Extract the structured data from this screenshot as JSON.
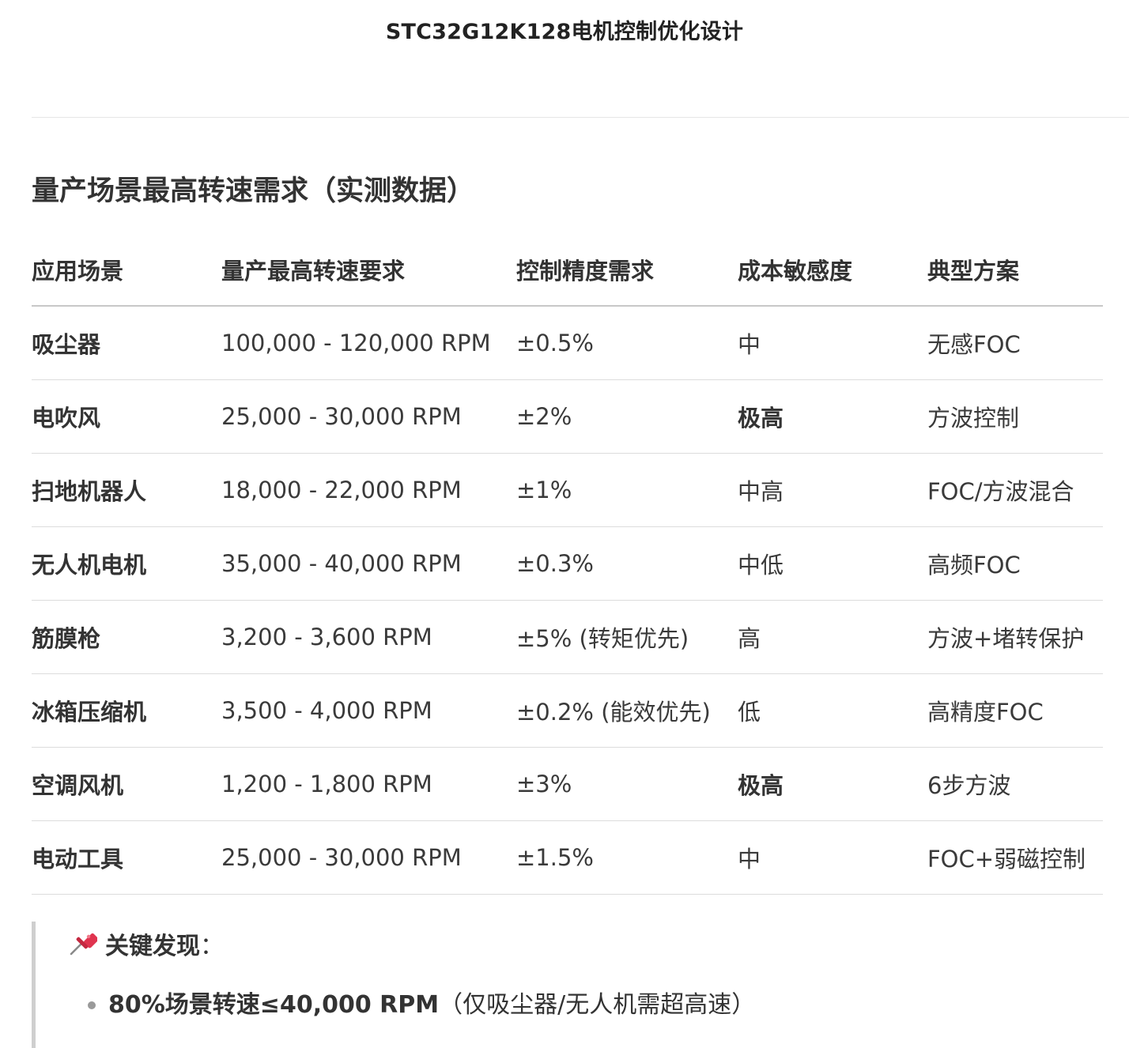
{
  "header": {
    "title": "STC32G12K128电机控制优化设计"
  },
  "section": {
    "title": "量产场景最高转速需求（实测数据）"
  },
  "table": {
    "columns": [
      "应用场景",
      "量产最高转速要求",
      "控制精度需求",
      "成本敏感度",
      "典型方案"
    ],
    "rows": [
      {
        "scene": "吸尘器",
        "speed": "100,000 - 120,000 RPM",
        "precision": "±0.5%",
        "cost": "中",
        "cost_emphasis": false,
        "solution": "无感FOC"
      },
      {
        "scene": "电吹风",
        "speed": "25,000 - 30,000 RPM",
        "precision": "±2%",
        "cost": "极高",
        "cost_emphasis": true,
        "solution": "方波控制"
      },
      {
        "scene": "扫地机器人",
        "speed": "18,000 - 22,000 RPM",
        "precision": "±1%",
        "cost": "中高",
        "cost_emphasis": false,
        "solution": "FOC/方波混合"
      },
      {
        "scene": "无人机电机",
        "speed": "35,000 - 40,000 RPM",
        "precision": "±0.3%",
        "cost": "中低",
        "cost_emphasis": false,
        "solution": "高频FOC"
      },
      {
        "scene": "筋膜枪",
        "speed": "3,200 - 3,600 RPM",
        "precision": "±5% (转矩优先)",
        "cost": "高",
        "cost_emphasis": false,
        "solution": "方波+堵转保护"
      },
      {
        "scene": "冰箱压缩机",
        "speed": "3,500 - 4,000 RPM",
        "precision": "±0.2% (能效优先)",
        "cost": "低",
        "cost_emphasis": false,
        "solution": "高精度FOC"
      },
      {
        "scene": "空调风机",
        "speed": "1,200 - 1,800 RPM",
        "precision": "±3%",
        "cost": "极高",
        "cost_emphasis": true,
        "solution": "6步方波"
      },
      {
        "scene": "电动工具",
        "speed": "25,000 - 30,000 RPM",
        "precision": "±1.5%",
        "cost": "中",
        "cost_emphasis": false,
        "solution": "FOC+弱磁控制"
      }
    ]
  },
  "callout": {
    "icon": "pushpin-icon",
    "heading": "关键发现",
    "heading_suffix": "：",
    "items": [
      {
        "strong": "80%场景转速≤40,000 RPM",
        "rest": "（仅吸尘器/无人机需超高速）"
      }
    ]
  }
}
